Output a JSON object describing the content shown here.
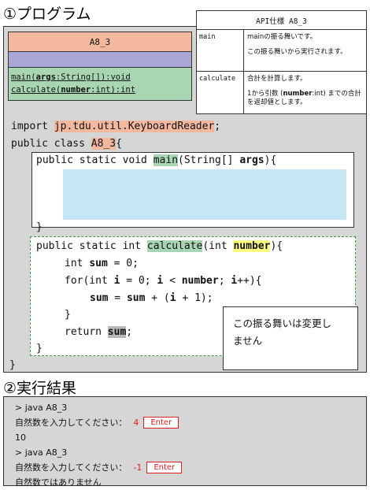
{
  "headings": {
    "program": "①プログラム",
    "result": "②実行結果"
  },
  "uml": {
    "class_name": "A8_3",
    "op1_name": "main",
    "op1_param": "args",
    "op1_rest": ":String[]):void",
    "op2_name": "calculate",
    "op2_param": "number",
    "op2_rest": ":int):int",
    "paren": "("
  },
  "api": {
    "title": "API仕様 A8_3",
    "rows": [
      {
        "name": "main",
        "desc1": "mainの振る舞いです。",
        "desc2": "この振る舞いから実行されます。"
      },
      {
        "name": "calculate",
        "desc1": "合計を計算します。",
        "desc2a": "1から引数 (",
        "desc2b": "number",
        "desc2c": ":int) までの合計を返却値とします。"
      }
    ]
  },
  "code": {
    "l1_kw": "import ",
    "l1_pkg": "jp.tdu.util.KeyboardReader",
    "l1_end": ";",
    "l2_kw": "public class ",
    "l2_cls": "A8_3",
    "l2_end": "{",
    "l3_kw": "public static void ",
    "l3_name": "main",
    "l3_a": "(String[] ",
    "l3_arg": "args",
    "l3_end": "){",
    "l4": "}",
    "l5_kw": "public static int ",
    "l5_name": "calculate",
    "l5_a": "(int ",
    "l5_arg": "number",
    "l5_end": "){",
    "l6_a": "int ",
    "l6_b": "sum",
    "l6_c": " = 0;",
    "l7_a": "for(int ",
    "l7_b": "i",
    "l7_c": " = 0; ",
    "l7_d": "i",
    "l7_e": " < ",
    "l7_f": "number",
    "l7_g": "; ",
    "l7_h": "i",
    "l7_i": "++){",
    "l8_a": "sum",
    "l8_b": " = ",
    "l8_c": "sum",
    "l8_d": " + (",
    "l8_e": "i",
    "l8_f": " + 1);",
    "l9": "}",
    "l10_a": "return ",
    "l10_b": "sum",
    "l10_c": ";",
    "l11": "}",
    "l12": "}"
  },
  "note": {
    "line1": "この振る舞いは変更し",
    "line2": "ません"
  },
  "result": {
    "cmd1": "> java A8_3",
    "prompt1": "自然数を入力してください：",
    "input1": "4",
    "enter1": "Enter",
    "out1": "10",
    "cmd2": "> java A8_3",
    "prompt2": "自然数を入力してください：",
    "input2": "-1",
    "enter2": "Enter",
    "out2": "自然数ではありません"
  },
  "colors": {
    "class_highlight": "#f4b89f",
    "method_highlight": "#a9d6b2",
    "param_highlight": "#ffff80",
    "edit_area": "#c4e6f5",
    "input_red": "#e02020"
  }
}
